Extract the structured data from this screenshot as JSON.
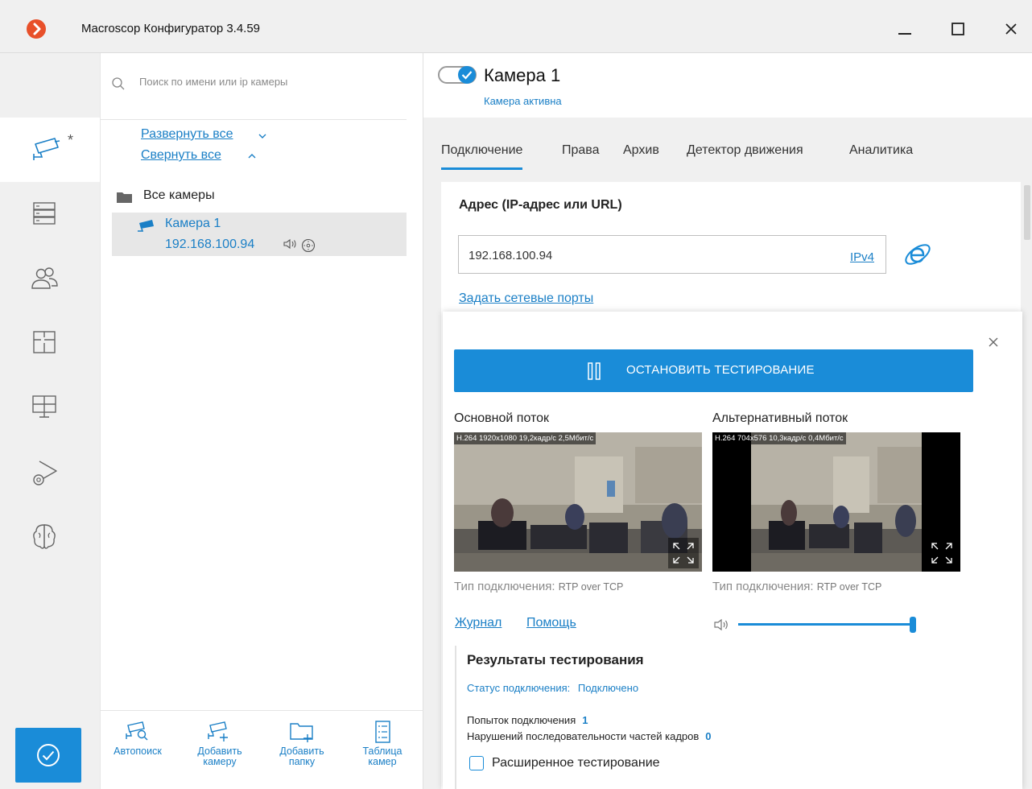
{
  "window": {
    "title": "Macroscop Конфигуратор 3.4.59"
  },
  "sidebar": {
    "active_marker": "*",
    "items": [
      {
        "icon": "camera-icon",
        "active": true
      },
      {
        "icon": "server-icon",
        "active": false
      },
      {
        "icon": "users-icon",
        "active": false
      },
      {
        "icon": "floor-plan-icon",
        "active": false
      },
      {
        "icon": "monitor-layout-icon",
        "active": false
      },
      {
        "icon": "video-settings-icon",
        "active": false
      },
      {
        "icon": "brain-icon",
        "active": false
      }
    ],
    "apply_icon": "checkmark-circle-icon"
  },
  "tree": {
    "search_placeholder": "Поиск по имени или ip камеры",
    "expand_all": "Развернуть все",
    "collapse_all": "Свернуть все",
    "root_folder": "Все камеры",
    "camera": {
      "name": "Камера 1",
      "ip": "192.168.100.94"
    },
    "toolbar": {
      "autosearch": "Автопоиск",
      "add_camera_l1": "Добавить",
      "add_camera_l2": "камеру",
      "add_folder_l1": "Добавить",
      "add_folder_l2": "папку",
      "table_l1": "Таблица",
      "table_l2": "камер"
    }
  },
  "camera": {
    "title": "Камера 1",
    "status": "Камера активна",
    "enabled": true,
    "tabs": [
      "Подключение",
      "Права",
      "Архив",
      "Детектор движения",
      "Аналитика"
    ],
    "active_tab": 0
  },
  "connection": {
    "address_label": "Адрес (IP-адрес или URL)",
    "address_value": "192.168.100.94",
    "ip_version": "IPv4",
    "ports_link": "Задать сетевые порты"
  },
  "test": {
    "stop_button": "ОСТАНОВИТЬ ТЕСТИРОВАНИЕ",
    "main_stream": {
      "label": "Основной поток",
      "info": "H.264 1920x1080 19,2кадр/с 2,5Мбит/с",
      "conn_type_label": "Тип подключения:",
      "conn_type_value": "RTP over TCP"
    },
    "alt_stream": {
      "label": "Альтернативный поток",
      "info": "H.264 704x576 10,3кадр/с 0,4Мбит/с",
      "conn_type_label": "Тип подключения:",
      "conn_type_value": "RTP over TCP"
    },
    "journal_link": "Журнал",
    "help_link": "Помощь",
    "volume_fraction": 1.0,
    "results": {
      "title": "Результаты тестирования",
      "status_label": "Статус подключения:",
      "status_value": "Подключено",
      "attempts_label": "Попыток подключения",
      "attempts_value": "1",
      "violations_label": "Нарушений последовательности частей кадров",
      "violations_value": "0"
    },
    "advanced_label": "Расширенное тестирование",
    "advanced_checked": false
  },
  "colors": {
    "accent": "#1a8cd8",
    "link": "#1a7fc6",
    "logo": "#e8502a"
  }
}
